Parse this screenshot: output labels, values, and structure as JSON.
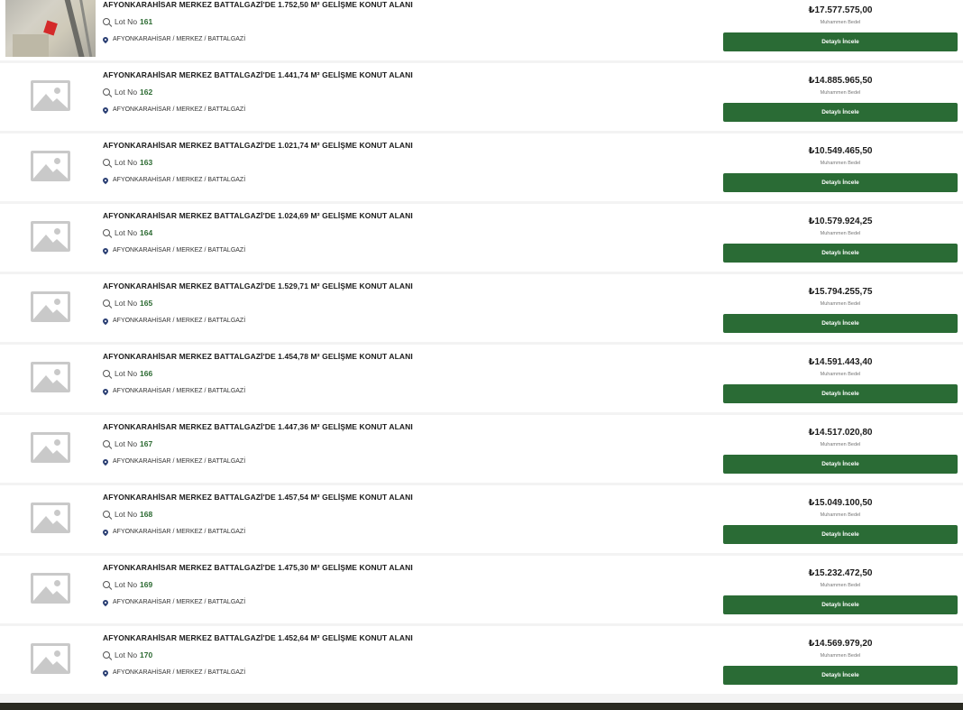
{
  "price_label": "Muhammen Bedel",
  "button_label": "Detaylı İncele",
  "lot_label": "Lot No",
  "items": [
    {
      "title": "AFYONKARAHİSAR MERKEZ BATTALGAZİ'DE 1.752,50 M² GELİŞME KONUT ALANI",
      "lot": "161",
      "location": "AFYONKARAHİSAR / MERKEZ / BATTALGAZİ",
      "price": "₺17.577.575,00",
      "image": "photo"
    },
    {
      "title": "AFYONKARAHİSAR MERKEZ BATTALGAZİ'DE 1.441,74 M² GELİŞME KONUT ALANI",
      "lot": "162",
      "location": "AFYONKARAHİSAR / MERKEZ / BATTALGAZİ",
      "price": "₺14.885.965,50",
      "image": "placeholder"
    },
    {
      "title": "AFYONKARAHİSAR MERKEZ BATTALGAZİ'DE 1.021,74 M² GELİŞME KONUT ALANI",
      "lot": "163",
      "location": "AFYONKARAHİSAR / MERKEZ / BATTALGAZİ",
      "price": "₺10.549.465,50",
      "image": "placeholder"
    },
    {
      "title": "AFYONKARAHİSAR MERKEZ BATTALGAZİ'DE 1.024,69 M² GELİŞME KONUT ALANI",
      "lot": "164",
      "location": "AFYONKARAHİSAR / MERKEZ / BATTALGAZİ",
      "price": "₺10.579.924,25",
      "image": "placeholder"
    },
    {
      "title": "AFYONKARAHİSAR MERKEZ BATTALGAZİ'DE 1.529,71 M² GELİŞME KONUT ALANI",
      "lot": "165",
      "location": "AFYONKARAHİSAR / MERKEZ / BATTALGAZİ",
      "price": "₺15.794.255,75",
      "image": "placeholder"
    },
    {
      "title": "AFYONKARAHİSAR MERKEZ BATTALGAZİ'DE 1.454,78 M² GELİŞME KONUT ALANI",
      "lot": "166",
      "location": "AFYONKARAHİSAR / MERKEZ / BATTALGAZİ",
      "price": "₺14.591.443,40",
      "image": "placeholder"
    },
    {
      "title": "AFYONKARAHİSAR MERKEZ BATTALGAZİ'DE 1.447,36 M² GELİŞME KONUT ALANI",
      "lot": "167",
      "location": "AFYONKARAHİSAR / MERKEZ / BATTALGAZİ",
      "price": "₺14.517.020,80",
      "image": "placeholder"
    },
    {
      "title": "AFYONKARAHİSAR MERKEZ BATTALGAZİ'DE 1.457,54 M² GELİŞME KONUT ALANI",
      "lot": "168",
      "location": "AFYONKARAHİSAR / MERKEZ / BATTALGAZİ",
      "price": "₺15.049.100,50",
      "image": "placeholder"
    },
    {
      "title": "AFYONKARAHİSAR MERKEZ BATTALGAZİ'DE 1.475,30 M² GELİŞME KONUT ALANI",
      "lot": "169",
      "location": "AFYONKARAHİSAR / MERKEZ / BATTALGAZİ",
      "price": "₺15.232.472,50",
      "image": "placeholder"
    },
    {
      "title": "AFYONKARAHİSAR MERKEZ BATTALGAZİ'DE 1.452,64 M² GELİŞME KONUT ALANI",
      "lot": "170",
      "location": "AFYONKARAHİSAR / MERKEZ / BATTALGAZİ",
      "price": "₺14.569.979,20",
      "image": "placeholder"
    }
  ],
  "colors": {
    "button_bg": "#2a6b35",
    "lot_number": "#2d6b33",
    "pin": "#2b3f73",
    "footer": "#2a2a22"
  },
  "icons": {
    "lot": "search-icon",
    "location": "pin-icon",
    "no_image": "image-placeholder-icon"
  }
}
